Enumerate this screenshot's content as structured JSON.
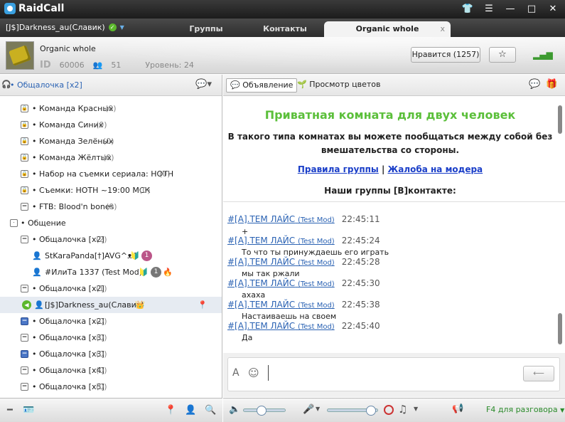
{
  "app": {
    "title": "RaidCall"
  },
  "user": {
    "name": "[J$]Darkness_au(Славик)"
  },
  "tabs": [
    {
      "label": "Группы"
    },
    {
      "label": "Контакты"
    },
    {
      "label": "Organic whole",
      "close": "x"
    }
  ],
  "group": {
    "name": "Organic whole",
    "id_label": "ID",
    "id": "60006",
    "members": "51",
    "level": "Уровень: 24",
    "like_button": "Нравится (1257)"
  },
  "left_panel": {
    "header": "• Общалочка [x2]"
  },
  "tree": [
    {
      "label": "• Команда Красных",
      "count": "(0)"
    },
    {
      "label": "• Команда Синих",
      "count": "(0)"
    },
    {
      "label": "• Команда Зелёных",
      "count": "(0)"
    },
    {
      "label": "• Команда Жёлтых",
      "count": "(0)"
    },
    {
      "label": "• Набор на съемки сериала: НОТН",
      "count": "(0)"
    },
    {
      "label": "• Съемки: НОТН ~19:00 МСК",
      "count": "(0)"
    },
    {
      "label": "• FTB: Blood'n bones",
      "count": "(0)"
    },
    {
      "label": "• Общение",
      "count": ""
    },
    {
      "label": "• Общалочка [x2]",
      "count": "(2)"
    },
    {
      "label": "StKaraPanda[†]AVG^ᴥ^",
      "count": ""
    },
    {
      "label": "#ИлиТа 1337 (Test Mod)",
      "count": ""
    },
    {
      "label": "• Общалочка [x2]",
      "count": "(1)"
    },
    {
      "label": "[J$]Darkness_au(Славик)",
      "count": ""
    },
    {
      "label": "• Общалочка [x2]",
      "count": "(0)"
    },
    {
      "label": "• Общалочка [x3]",
      "count": "(0)"
    },
    {
      "label": "• Общалочка [x3]",
      "count": "(0)"
    },
    {
      "label": "• Общалочка [x4]",
      "count": "(0)"
    },
    {
      "label": "• Общалочка [x5]",
      "count": "(0)"
    }
  ],
  "toolbar": {
    "announce": "Объявление",
    "colors": "Просмотр цветов"
  },
  "announcement": {
    "title": "Приватная комната для двух человек",
    "line1": "В такого типа комнатах вы можете пообщаться между собой без",
    "line2": "вмешательства со стороны.",
    "link1": "Правила группы",
    "sep": "|",
    "link2": "Жалоба на модера",
    "groups": "Наши группы [В]контакте:"
  },
  "messages": [
    {
      "who": "#[A].ТЕМ ЛАЙС",
      "tag": "(Test Mod)",
      "time": "22:45:11",
      "text": "+"
    },
    {
      "who": "#[A].ТЕМ ЛАЙС",
      "tag": "(Test Mod)",
      "time": "22:45:24",
      "text": "То что ты принуждаешь его играть"
    },
    {
      "who": "#[A].ТЕМ ЛАЙС",
      "tag": "(Test Mod)",
      "time": "22:45:28",
      "text": "мы так ржали"
    },
    {
      "who": "#[A].ТЕМ ЛАЙС",
      "tag": "(Test Mod)",
      "time": "22:45:30",
      "text": "ахаха"
    },
    {
      "who": "#[A].ТЕМ ЛАЙС",
      "tag": "(Test Mod)",
      "time": "22:45:38",
      "text": "Настаиваешь на своем"
    },
    {
      "who": "#[A].ТЕМ ЛАЙС",
      "tag": "(Test Mod)",
      "time": "22:45:40",
      "text": "Да"
    }
  ],
  "bottom": {
    "talk_key": "F4 для разговора"
  },
  "colors": {
    "accent": "#2a62b3",
    "title_green": "#5bbf3a",
    "link_blue": "#1a3ec8"
  }
}
